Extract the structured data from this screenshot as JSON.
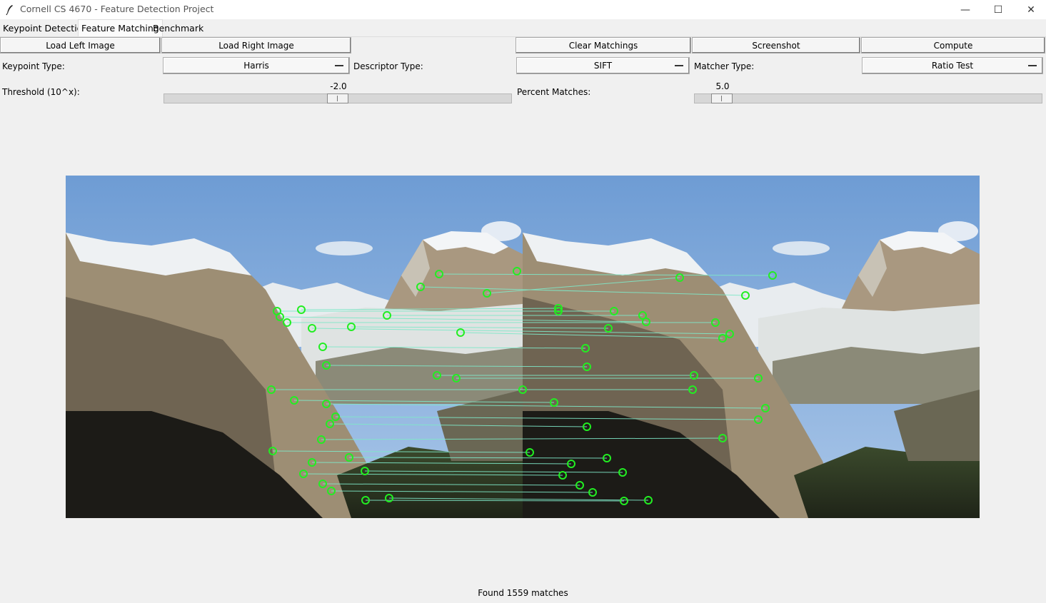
{
  "window": {
    "title": "Cornell CS 4670 - Feature Detection Project",
    "controls": {
      "minimize": "—",
      "maximize": "☐",
      "close": "✕"
    }
  },
  "tabs": [
    {
      "label": "Keypoint Detection",
      "active": false
    },
    {
      "label": "Feature Matching",
      "active": true
    },
    {
      "label": "Benchmark",
      "active": false
    }
  ],
  "toolbar": {
    "load_left": "Load Left Image",
    "load_right": "Load Right Image",
    "clear": "Clear Matchings",
    "screenshot": "Screenshot",
    "compute": "Compute"
  },
  "options": {
    "keypoint_label": "Keypoint Type:",
    "keypoint_value": "Harris",
    "descriptor_label": "Descriptor Type:",
    "descriptor_value": "SIFT",
    "matcher_label": "Matcher Type:",
    "matcher_value": "Ratio Test"
  },
  "sliders": {
    "threshold_label": "Threshold (10^x):",
    "threshold_value": "-2.0",
    "threshold_fraction": 0.5,
    "percent_label": "Percent Matches:",
    "percent_value": "5.0",
    "percent_fraction": 0.05
  },
  "status": "Found 1559 matches",
  "colors": {
    "keypoint": "#22ee22",
    "match_line": "#7fe8c8",
    "sky": "#7fa6d6"
  }
}
